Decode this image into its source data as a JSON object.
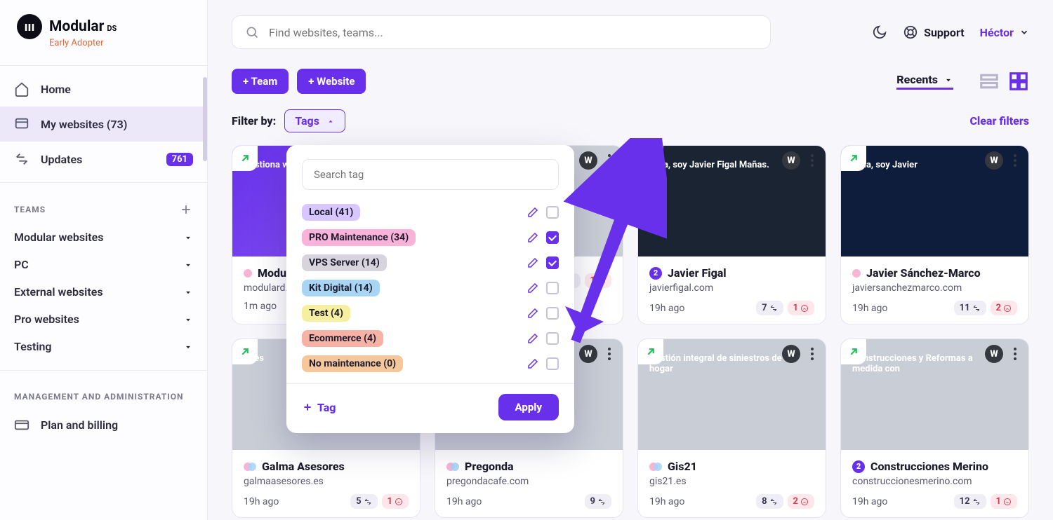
{
  "logo": {
    "main": "Modular",
    "sup": "DS",
    "sub": "Early Adopter"
  },
  "search": {
    "placeholder": "Find websites, teams..."
  },
  "top": {
    "support": "Support",
    "user": "Héctor"
  },
  "nav": {
    "home": "Home",
    "mywebsites": "My websites (73)",
    "updates": "Updates",
    "updates_badge": "761"
  },
  "sections": {
    "teams": "TEAMS",
    "mgmt": "MANAGEMENT AND ADMINISTRATION"
  },
  "teams": [
    {
      "label": "Modular websites"
    },
    {
      "label": "PC"
    },
    {
      "label": "External websites"
    },
    {
      "label": "Pro websites"
    },
    {
      "label": "Testing"
    }
  ],
  "plan": "Plan and billing",
  "buttons": {
    "add_team": "+ Team",
    "add_website": "+ Website",
    "apply": "Apply",
    "add_tag": "Tag"
  },
  "sort": {
    "label": "Recents"
  },
  "filter": {
    "label": "Filter by:",
    "tags": "Tags",
    "clear": "Clear filters"
  },
  "popup": {
    "search_placeholder": "Search tag",
    "tags": [
      {
        "label": "Local (41)",
        "color": "#d7c6ff",
        "checked": false
      },
      {
        "label": "PRO Maintenance (34)",
        "color": "#f9b2d9",
        "checked": true
      },
      {
        "label": "VPS Server (14)",
        "color": "#d7d4de",
        "checked": true
      },
      {
        "label": "Kit Digital (14)",
        "color": "#a9d5f5",
        "checked": false
      },
      {
        "label": "Test (4)",
        "color": "#f5ef9f",
        "checked": false
      },
      {
        "label": "Ecommerce (4)",
        "color": "#f7b2a6",
        "checked": false
      },
      {
        "label": "No maintenance (0)",
        "color": "#f6c79a",
        "checked": false
      }
    ]
  },
  "cards": [
    {
      "title": "Modular",
      "url": "modulard...",
      "age": "1m ago",
      "icon": "dot",
      "t1": "",
      "t2": "",
      "thumb": "purple",
      "thumb_text": "Gestiona webs de desde un"
    },
    {
      "title": "",
      "url": "",
      "age": "",
      "icon": "",
      "t1": "1",
      "t2": "1",
      "thumb": "img",
      "thumb_text": ""
    },
    {
      "title": "Javier Figal",
      "url": "javierfigal.com",
      "age": "19h ago",
      "icon": "num2",
      "t1": "7",
      "t2": "1",
      "thumb": "dark",
      "thumb_text": "Hola, soy Javier Figal Mañas."
    },
    {
      "title": "Javier Sánchez-Marco",
      "url": "javiersanchezmarco.com",
      "age": "19h ago",
      "icon": "dot",
      "t1": "11",
      "t2": "2",
      "thumb": "blue",
      "thumb_text": "Hola, soy Javier"
    },
    {
      "title": "Galma Asesores",
      "url": "galmaasesores.es",
      "age": "19h ago",
      "icon": "dual",
      "t1": "5",
      "t2": "1",
      "thumb": "img",
      "thumb_text": "Ases"
    },
    {
      "title": "Pregonda",
      "url": "pregondacafe.com",
      "age": "19h ago",
      "icon": "dual",
      "t1": "9",
      "t2": "",
      "thumb": "img",
      "thumb_text": ""
    },
    {
      "title": "Gis21",
      "url": "gis21.es",
      "age": "19h ago",
      "icon": "dual",
      "t1": "8",
      "t2": "2",
      "thumb": "img",
      "thumb_text": "Gestión integral de siniestros de hogar"
    },
    {
      "title": "Construcciones Merino",
      "url": "construccionesmerino.com",
      "age": "19h ago",
      "icon": "num2",
      "t1": "12",
      "t2": "1",
      "thumb": "img",
      "thumb_text": "Construcciones y Reformas a medida con"
    }
  ]
}
